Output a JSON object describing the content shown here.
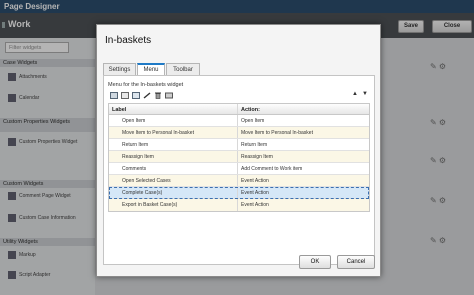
{
  "app": {
    "title": "Page Designer"
  },
  "toolbar": {
    "page_title": "Work",
    "save_label": "Save",
    "close_label": "Close"
  },
  "left_panel": {
    "filter_placeholder": "Filter widgets",
    "categories": [
      {
        "label": "Case Widgets"
      },
      {
        "label": "Custom Properties Widgets"
      },
      {
        "label": "Custom Widgets"
      },
      {
        "label": "Utility Widgets"
      }
    ],
    "widgets": [
      {
        "label": "Attachments"
      },
      {
        "label": "Calendar"
      },
      {
        "label": "Custom Properties Widget"
      },
      {
        "label": "Comment Page Widget"
      },
      {
        "label": "Custom Case Information"
      },
      {
        "label": "Markup"
      },
      {
        "label": "Script Adapter"
      }
    ]
  },
  "dialog": {
    "title": "In-baskets",
    "tabs": [
      {
        "label": "Settings"
      },
      {
        "label": "Menu"
      },
      {
        "label": "Toolbar"
      }
    ],
    "menu_label": "Menu for the In-baskets widget",
    "table": {
      "headers": [
        "Label",
        "Action:"
      ],
      "rows": [
        {
          "label": "Open Item",
          "action": "Open Item"
        },
        {
          "label": "Move Item to Personal In-basket",
          "action": "Move Item to Personal In-basket"
        },
        {
          "label": "Return Item",
          "action": "Return Item"
        },
        {
          "label": "Reassign Item",
          "action": "Reassign Item"
        },
        {
          "label": "Comments",
          "action": "Add Comment to Work item"
        },
        {
          "label": "Open Selected Cases",
          "action": "Event Action"
        },
        {
          "label": "Complete Case(s)",
          "action": "Event Action"
        },
        {
          "label": "Export in Basket Case(s)",
          "action": "Event Action"
        }
      ]
    },
    "ok_label": "OK",
    "cancel_label": "Cancel"
  },
  "icons": [
    "add-icon",
    "edit-icon",
    "delete-icon",
    "move-up-icon",
    "move-down-icon",
    "settings-icon",
    "collapse-icon"
  ]
}
